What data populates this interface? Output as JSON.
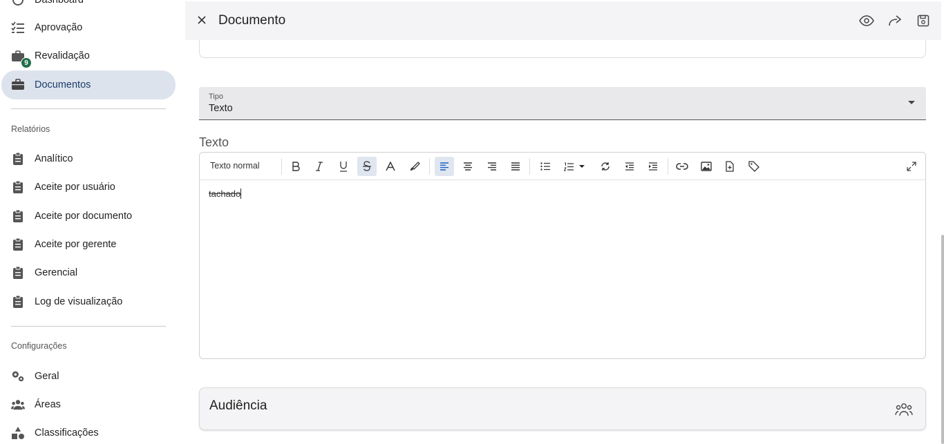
{
  "sidebar": {
    "items_top": [
      {
        "label": "Dashboard",
        "icon": "dashboard-icon"
      },
      {
        "label": "Aprovação",
        "icon": "checklist-icon"
      },
      {
        "label": "Revalidação",
        "icon": "briefcase-clock-icon",
        "badge": "9"
      },
      {
        "label": "Documentos",
        "icon": "briefcase-icon",
        "active": true
      }
    ],
    "reports_label": "Relatórios",
    "reports": [
      {
        "label": "Analítico"
      },
      {
        "label": "Aceite por usuário"
      },
      {
        "label": "Aceite por documento"
      },
      {
        "label": "Aceite por gerente"
      },
      {
        "label": "Gerencial"
      },
      {
        "label": "Log de visualização"
      }
    ],
    "settings_label": "Configurações",
    "settings": [
      {
        "label": "Geral",
        "icon": "gears-icon"
      },
      {
        "label": "Áreas",
        "icon": "users-icon"
      },
      {
        "label": "Classificações",
        "icon": "shapes-icon"
      }
    ]
  },
  "header": {
    "title": "Documento"
  },
  "form": {
    "tipo_label": "Tipo",
    "tipo_value": "Texto",
    "texto_heading": "Texto"
  },
  "editor": {
    "paragraph_style": "Texto normal",
    "content": "tachado",
    "active_buttons": [
      "strikethrough",
      "align-left"
    ]
  },
  "audience": {
    "title": "Audiência"
  },
  "colors": {
    "active_nav_bg": "#dde3ec",
    "badge": "#1f6f4a",
    "topbar_bg": "#f4f3f5"
  }
}
